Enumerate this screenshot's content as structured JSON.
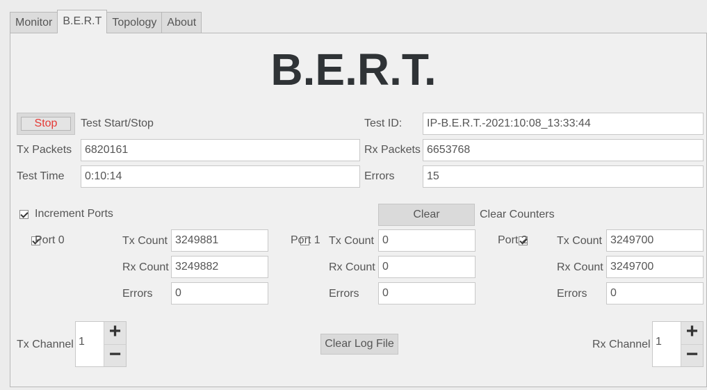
{
  "tabs": [
    "Monitor",
    "B.E.R.T",
    "Topology",
    "About"
  ],
  "title": "B.E.R.T.",
  "test": {
    "stop_label": "Stop",
    "start_stop_label": "Test Start/Stop",
    "test_id_label": "Test ID:",
    "test_id_value": "IP-B.E.R.T.-2021:10:08_13:33:44",
    "tx_packets_label": "Tx Packets",
    "tx_packets_value": "6820161",
    "rx_packets_label": "Rx Packets",
    "rx_packets_value": "6653768",
    "test_time_label": "Test Time",
    "test_time_value": "0:10:14",
    "errors_label": "Errors",
    "errors_value": "15"
  },
  "increment_ports": {
    "label": "Increment Ports",
    "checked": true
  },
  "clear": {
    "button": "Clear",
    "label": "Clear Counters"
  },
  "ports": [
    {
      "label": "Port 0",
      "checked": true,
      "tx_label": "Tx Count",
      "tx": "3249881",
      "rx_label": "Rx Count",
      "rx": "3249882",
      "err_label": "Errors",
      "errors": "0"
    },
    {
      "label": "Port 1",
      "checked": false,
      "tx_label": "Tx Count",
      "tx": "0",
      "rx_label": "Rx Count",
      "rx": "0",
      "err_label": "Errors",
      "errors": "0"
    },
    {
      "label": "Port 2",
      "checked": true,
      "tx_label": "Tx Count",
      "tx": "3249700",
      "rx_label": "Rx Count",
      "rx": "3249700",
      "err_label": "Errors",
      "errors": "0"
    }
  ],
  "tx_channel": {
    "label": "Tx Channel",
    "value": "1",
    "plus": "+",
    "minus": "−"
  },
  "rx_channel": {
    "label": "Rx Channel",
    "value": "1",
    "plus": "+",
    "minus": "−"
  },
  "clear_log_label": "Clear Log File"
}
